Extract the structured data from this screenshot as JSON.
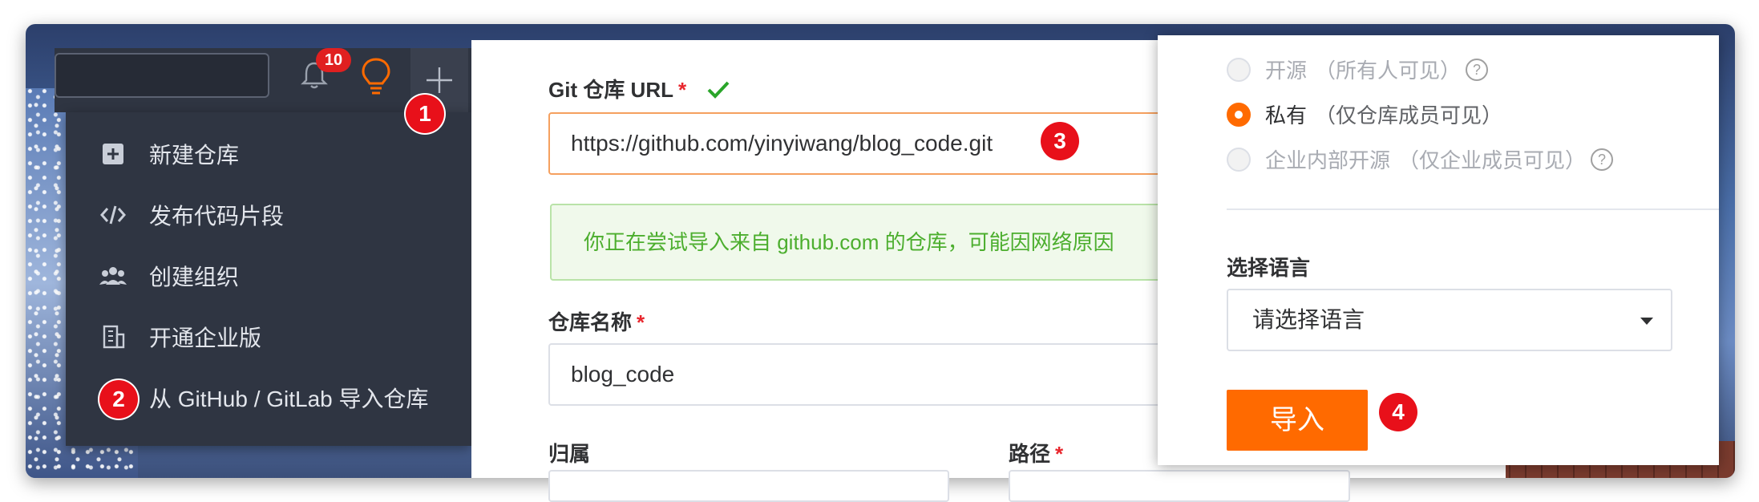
{
  "nav": {
    "notification_count": "10"
  },
  "dropdown": {
    "items": [
      {
        "label": "新建仓库",
        "icon": "plus-square-icon"
      },
      {
        "label": "发布代码片段",
        "icon": "code-icon"
      },
      {
        "label": "创建组织",
        "icon": "users-icon"
      },
      {
        "label": "开通企业版",
        "icon": "building-icon"
      },
      {
        "label": "从 GitHub / GitLab 导入仓库",
        "icon": "import-icon"
      }
    ]
  },
  "form": {
    "git_url_label": "Git 仓库 URL",
    "git_url_value": "https://github.com/yinyiwang/blog_code.git",
    "notice": "你正在尝试导入来自 github.com 的仓库，可能因网络原因",
    "repo_name_label": "仓库名称",
    "repo_name_value": "blog_code",
    "owner_label": "归属",
    "path_label": "路径",
    "required_mark": "*"
  },
  "panel": {
    "visibility": [
      {
        "label": "开源",
        "hint": "（所有人可见）",
        "help": true,
        "selected": false
      },
      {
        "label": "私有",
        "hint": "（仅仓库成员可见）",
        "help": false,
        "selected": true
      },
      {
        "label": "企业内部开源",
        "hint": "（仅企业成员可见）",
        "help": true,
        "selected": false
      }
    ],
    "language_label": "选择语言",
    "language_placeholder": "请选择语言",
    "import_button": "导入"
  },
  "callouts": [
    "1",
    "2",
    "3",
    "4"
  ],
  "colors": {
    "accent": "#ff6a00",
    "callout": "#e8101a",
    "nav_bg": "#2f3542",
    "success": "#4cae2e"
  }
}
